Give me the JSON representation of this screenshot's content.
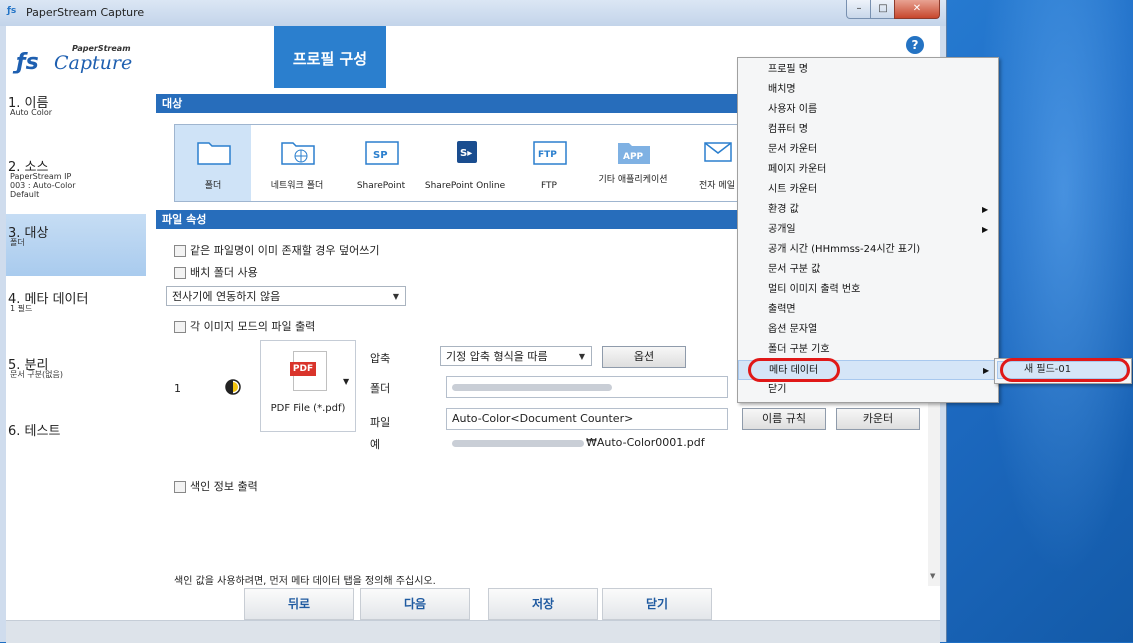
{
  "window": {
    "title": "PaperStream Capture"
  },
  "header": {
    "logo_small": "PaperStream",
    "logo_big": "Capture",
    "tab_label": "프로필 구성",
    "help": "?"
  },
  "nav": [
    {
      "title": "1. 이름",
      "sub": [
        "Auto Color"
      ]
    },
    {
      "title": "2. 소스",
      "sub": [
        "PaperStream IP",
        "003 : Auto-Color",
        "Default"
      ]
    },
    {
      "title": "3. 대상",
      "sub": [
        "폴더"
      ]
    },
    {
      "title": "4. 메타 데이터",
      "sub": [
        "1 필드"
      ]
    },
    {
      "title": "5. 분리",
      "sub": [
        "문서 구분(없음)"
      ]
    },
    {
      "title": "6. 테스트",
      "sub": []
    }
  ],
  "destination": {
    "section_title": "대상",
    "items": [
      {
        "label": "폴더",
        "icon": "folder-icon"
      },
      {
        "label": "네트워크 폴더",
        "icon": "network-folder-icon"
      },
      {
        "label": "SharePoint",
        "icon": "sharepoint-icon",
        "badge": "SP"
      },
      {
        "label": "SharePoint Online",
        "icon": "sharepoint-online-icon",
        "badge": "S▸"
      },
      {
        "label": "FTP",
        "icon": "ftp-icon",
        "badge": "FTP"
      },
      {
        "label": "기타 애플리케이션",
        "icon": "other-app-icon",
        "badge": "APP"
      },
      {
        "label": "전자 메일",
        "icon": "email-icon"
      }
    ]
  },
  "file_props": {
    "section_title": "파일 속성",
    "overwrite": "같은 파일명이 이미 존재할 경우 덮어쓰기",
    "batch_folder": "배치 폴더 사용",
    "scanner_link_select": "전사기에 연동하지 않음",
    "per_mode_output": "각 이미지 모드의 파일 출력",
    "row_index": "1",
    "file_type": "PDF File (*.pdf)",
    "pdf_tag": "PDF",
    "compression_label": "압축",
    "compression_value": "기정 압축 형식을 따름",
    "options_button": "옵션",
    "folder_label": "폴더",
    "file_label": "파일",
    "file_value": "Auto-Color<Document Counter>",
    "naming_rule_button": "이름 규칙",
    "counter_button": "카운터",
    "example_label": "예",
    "example_value": "₩Auto-Color0001.pdf",
    "index_output": "색인 정보 출력",
    "hint": "색인 값을 사용하려면, 먼저 메타 데이터 탭을 정의해 주십시오."
  },
  "footer": {
    "back": "뒤로",
    "next": "다음",
    "save": "저장",
    "close": "닫기"
  },
  "context_menu": {
    "items": [
      {
        "label": "프로필 명",
        "submenu": false
      },
      {
        "label": "배치명",
        "submenu": false
      },
      {
        "label": "사용자 이름",
        "submenu": false
      },
      {
        "label": "컴퓨터 명",
        "submenu": false
      },
      {
        "label": "문서 카운터",
        "submenu": false
      },
      {
        "label": "페이지 카운터",
        "submenu": false
      },
      {
        "label": "시트 카운터",
        "submenu": false
      },
      {
        "label": "환경 값",
        "submenu": true
      },
      {
        "label": "공개일",
        "submenu": true
      },
      {
        "label": "공개 시간 (HHmmss-24시간 표기)",
        "submenu": false
      },
      {
        "label": "문서 구분 값",
        "submenu": false
      },
      {
        "label": "멀티 이미지 출력 번호",
        "submenu": false
      },
      {
        "label": "출력면",
        "submenu": false
      },
      {
        "label": "옵션 문자열",
        "submenu": false
      },
      {
        "label": "폴더 구분 기호",
        "submenu": false
      },
      {
        "label": "메타 데이터",
        "submenu": true
      },
      {
        "label": "닫기",
        "submenu": false
      }
    ],
    "highlighted_index": 15,
    "submenu_item": "새 필드-01",
    "highlight_color": "#e01818"
  }
}
